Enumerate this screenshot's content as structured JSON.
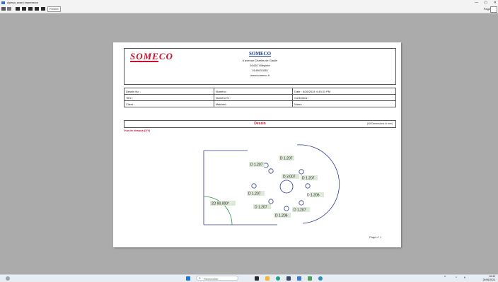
{
  "window": {
    "title": "Aperçu avant impression",
    "controls": {
      "minimize": "—",
      "maximize": "▢",
      "close": "✕"
    }
  },
  "toolbar": {
    "close_label": "Fermer",
    "page_label": "Page"
  },
  "header": {
    "logo_text": "SOMECO",
    "company_name": "SOMECO",
    "address_line1": "6 avenue Charles de Gaulle",
    "address_line2": "93420 Villepinte",
    "phone": "0149631630",
    "website": "www.someco.fr"
  },
  "info_table": {
    "rows": [
      [
        "Dessin No :",
        "Numéro :",
        "Date : 6/26/2024 4:43:31 PM"
      ],
      [
        "Titre :",
        "Numéro Sr :",
        "Contrôleur :"
      ],
      [
        "Client :",
        "Matériel :",
        "Notes :"
      ]
    ]
  },
  "drawing": {
    "section_title": "Dessin",
    "dimensions_note": "(All Dimensions in mm)",
    "view_label": "Vue de dessus (XY)",
    "angle_label": "2D 90.000°",
    "hole_labels": [
      "D 1.207",
      "D 1.207",
      "D 3.007",
      "D 1.207",
      "D 1.207",
      "D 1.206",
      "D 1.207",
      "D 1.207",
      "D 1.206"
    ]
  },
  "footer": {
    "page_number": "Page n° 1"
  },
  "taskbar": {
    "search_placeholder": "Rechercher",
    "time": "16:43",
    "date": "26/06/2024"
  }
}
